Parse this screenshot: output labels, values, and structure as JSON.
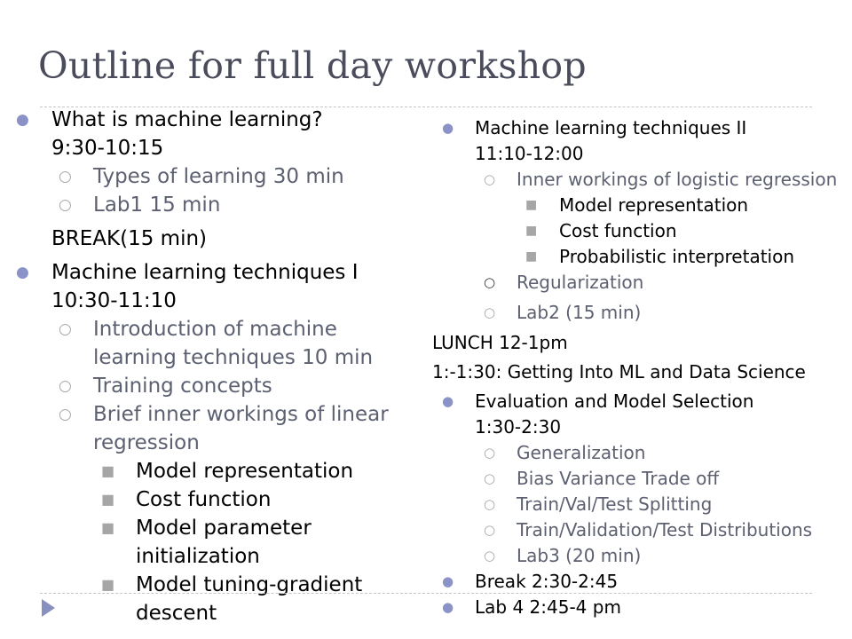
{
  "slide": {
    "title": "Outline for full day workshop"
  },
  "colors": {
    "title": "#4a4c5c",
    "bullet": "#8a92c8",
    "sub_text": "#5c6070",
    "sub_marker": "#a6a6a6",
    "rule": "#c4c4c4",
    "play_icon": "#8890c0"
  },
  "markers": {
    "level1": "●",
    "level2": "○",
    "level3": "■"
  },
  "left_column": {
    "s1": {
      "line1": "What is machine learning?",
      "line2": "9:30-10:15",
      "sub1": "Types of learning 30 min",
      "sub2": "Lab1 15 min"
    },
    "break": "BREAK(15 min)",
    "s2": {
      "line1": "Machine learning techniques I",
      "line2": "10:30-11:10",
      "sub1_a": "Introduction of machine",
      "sub1_b": "learning techniques 10 min",
      "sub2": "Training concepts",
      "sub3_a": "Brief inner workings of linear",
      "sub3_b": "regression",
      "d1": "Model representation",
      "d2": "Cost function",
      "d3_a": "Model parameter",
      "d3_b": "initialization",
      "d4_a": "Model tuning-gradient",
      "d4_b": "descent"
    }
  },
  "right_column": {
    "s3": {
      "line1": "Machine learning techniques II",
      "line2": "11:10-12:00",
      "sub1": "Inner workings of logistic regression",
      "d1": "Model representation",
      "d2": "Cost function",
      "d3": "Probabilistic interpretation",
      "sub2": "Regularization",
      "sub3": "Lab2 (15 min)"
    },
    "lunch": "LUNCH 12-1pm",
    "talk": "1:-1:30: Getting Into ML and Data Science",
    "s4": {
      "line1": "Evaluation and Model Selection",
      "line2": "1:30-2:30",
      "sub1": "Generalization",
      "sub2": "Bias Variance Trade off",
      "sub3": "Train/Val/Test Splitting",
      "sub4": "Train/Validation/Test Distributions",
      "sub5": "Lab3 (20  min)"
    },
    "break2": "Break 2:30-2:45",
    "lab4": "Lab 4 2:45-4 pm"
  }
}
